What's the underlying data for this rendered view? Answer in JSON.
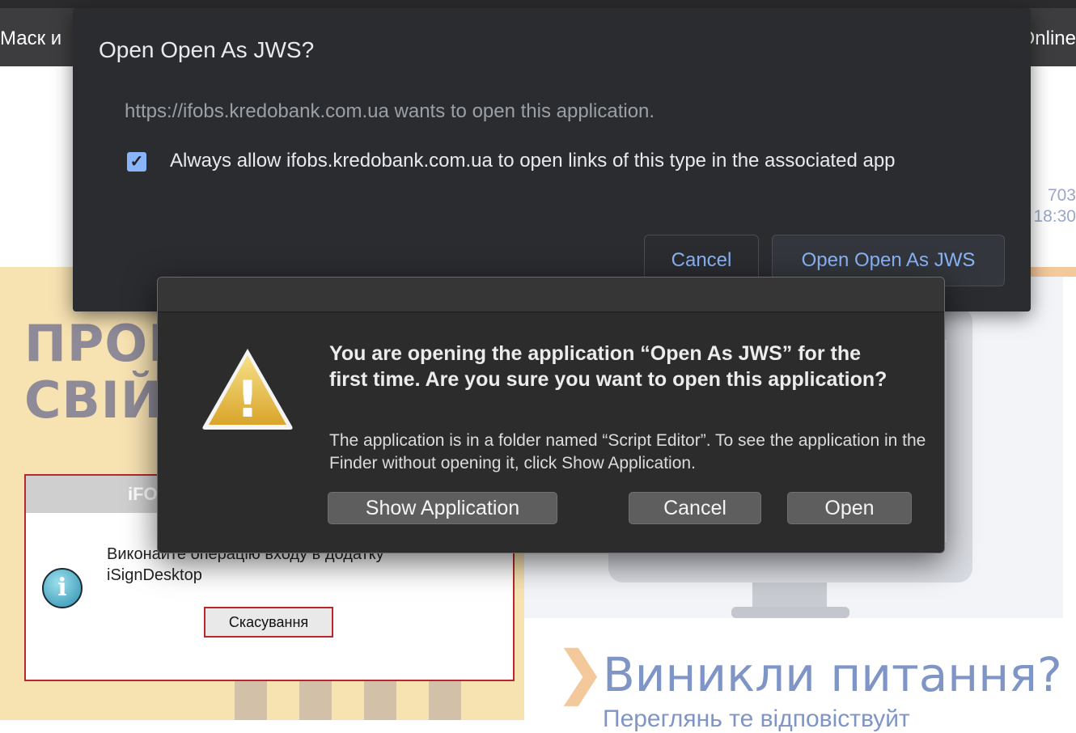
{
  "background_page": {
    "nav_left": "Маск и",
    "nav_right": "Online",
    "side_info": [
      "703",
      "18:30"
    ],
    "hero_title_lines": [
      "ПРОК",
      "СВІЙ А"
    ],
    "question_arrow": "❯",
    "question_title": "Виникли питання?",
    "question_subtitle": "Переглянь те відповіствуйт",
    "ifobs_dialog": {
      "title": "iFO",
      "info_glyph": "i",
      "message": "Виконайте операцію входу в додатку iSignDesktop",
      "cancel_label": "Скасування"
    }
  },
  "chrome_dialog": {
    "title": "Open Open As JWS?",
    "origin_text": "https://ifobs.kredobank.com.ua wants to open this application.",
    "checkbox_checked": true,
    "checkbox_glyph": "✓",
    "checkbox_label": "Always allow ifobs.kredobank.com.ua to open links of this type in the associated app",
    "cancel_label": "Cancel",
    "open_label": "Open Open As JWS",
    "accent_color": "#8ab4f8"
  },
  "mac_dialog": {
    "icon": "warning-triangle-icon",
    "warning_glyph": "!",
    "heading": "You are opening the application “Open As JWS” for the first time. Are you sure you want to open this application?",
    "body": "The application is in a folder named “Script Editor”. To see the application in the Finder without opening it, click Show Application.",
    "show_application_label": "Show Application",
    "cancel_label": "Cancel",
    "open_label": "Open"
  }
}
